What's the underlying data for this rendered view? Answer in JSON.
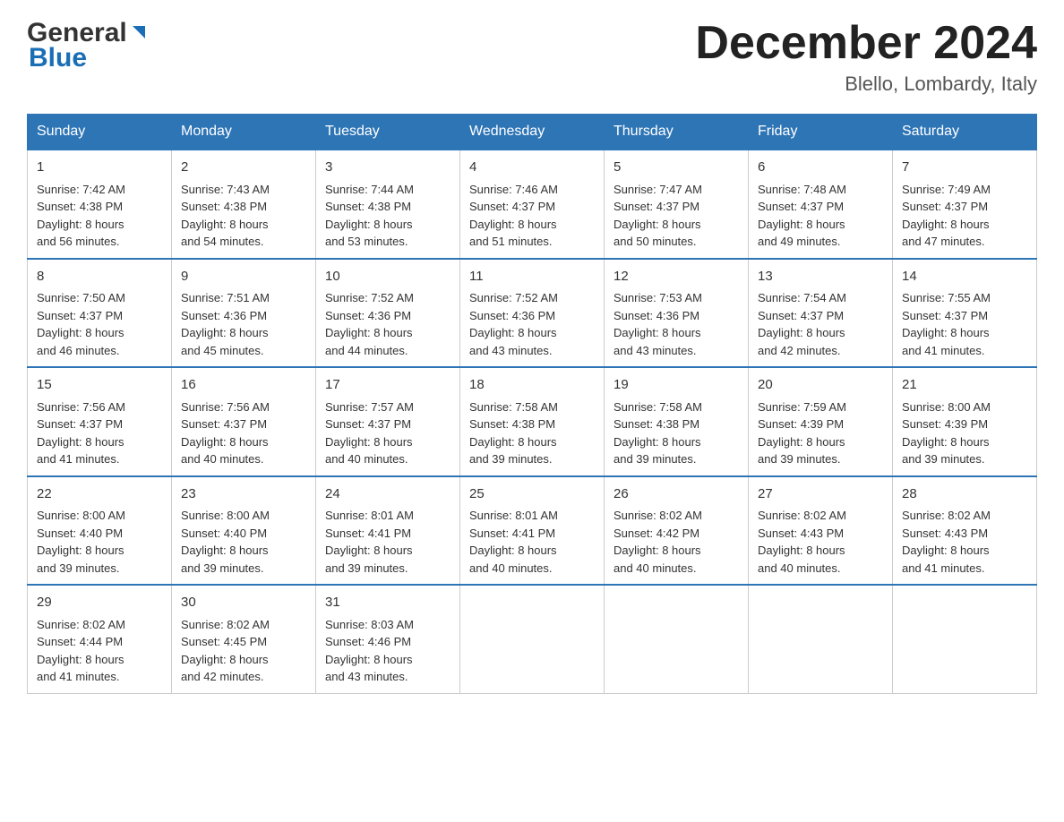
{
  "header": {
    "logo_line1": "General",
    "logo_line2": "Blue",
    "title": "December 2024",
    "subtitle": "Blello, Lombardy, Italy"
  },
  "days_of_week": [
    "Sunday",
    "Monday",
    "Tuesday",
    "Wednesday",
    "Thursday",
    "Friday",
    "Saturday"
  ],
  "weeks": [
    [
      {
        "num": "1",
        "sunrise": "7:42 AM",
        "sunset": "4:38 PM",
        "daylight": "8 hours and 56 minutes."
      },
      {
        "num": "2",
        "sunrise": "7:43 AM",
        "sunset": "4:38 PM",
        "daylight": "8 hours and 54 minutes."
      },
      {
        "num": "3",
        "sunrise": "7:44 AM",
        "sunset": "4:38 PM",
        "daylight": "8 hours and 53 minutes."
      },
      {
        "num": "4",
        "sunrise": "7:46 AM",
        "sunset": "4:37 PM",
        "daylight": "8 hours and 51 minutes."
      },
      {
        "num": "5",
        "sunrise": "7:47 AM",
        "sunset": "4:37 PM",
        "daylight": "8 hours and 50 minutes."
      },
      {
        "num": "6",
        "sunrise": "7:48 AM",
        "sunset": "4:37 PM",
        "daylight": "8 hours and 49 minutes."
      },
      {
        "num": "7",
        "sunrise": "7:49 AM",
        "sunset": "4:37 PM",
        "daylight": "8 hours and 47 minutes."
      }
    ],
    [
      {
        "num": "8",
        "sunrise": "7:50 AM",
        "sunset": "4:37 PM",
        "daylight": "8 hours and 46 minutes."
      },
      {
        "num": "9",
        "sunrise": "7:51 AM",
        "sunset": "4:36 PM",
        "daylight": "8 hours and 45 minutes."
      },
      {
        "num": "10",
        "sunrise": "7:52 AM",
        "sunset": "4:36 PM",
        "daylight": "8 hours and 44 minutes."
      },
      {
        "num": "11",
        "sunrise": "7:52 AM",
        "sunset": "4:36 PM",
        "daylight": "8 hours and 43 minutes."
      },
      {
        "num": "12",
        "sunrise": "7:53 AM",
        "sunset": "4:36 PM",
        "daylight": "8 hours and 43 minutes."
      },
      {
        "num": "13",
        "sunrise": "7:54 AM",
        "sunset": "4:37 PM",
        "daylight": "8 hours and 42 minutes."
      },
      {
        "num": "14",
        "sunrise": "7:55 AM",
        "sunset": "4:37 PM",
        "daylight": "8 hours and 41 minutes."
      }
    ],
    [
      {
        "num": "15",
        "sunrise": "7:56 AM",
        "sunset": "4:37 PM",
        "daylight": "8 hours and 41 minutes."
      },
      {
        "num": "16",
        "sunrise": "7:56 AM",
        "sunset": "4:37 PM",
        "daylight": "8 hours and 40 minutes."
      },
      {
        "num": "17",
        "sunrise": "7:57 AM",
        "sunset": "4:37 PM",
        "daylight": "8 hours and 40 minutes."
      },
      {
        "num": "18",
        "sunrise": "7:58 AM",
        "sunset": "4:38 PM",
        "daylight": "8 hours and 39 minutes."
      },
      {
        "num": "19",
        "sunrise": "7:58 AM",
        "sunset": "4:38 PM",
        "daylight": "8 hours and 39 minutes."
      },
      {
        "num": "20",
        "sunrise": "7:59 AM",
        "sunset": "4:39 PM",
        "daylight": "8 hours and 39 minutes."
      },
      {
        "num": "21",
        "sunrise": "8:00 AM",
        "sunset": "4:39 PM",
        "daylight": "8 hours and 39 minutes."
      }
    ],
    [
      {
        "num": "22",
        "sunrise": "8:00 AM",
        "sunset": "4:40 PM",
        "daylight": "8 hours and 39 minutes."
      },
      {
        "num": "23",
        "sunrise": "8:00 AM",
        "sunset": "4:40 PM",
        "daylight": "8 hours and 39 minutes."
      },
      {
        "num": "24",
        "sunrise": "8:01 AM",
        "sunset": "4:41 PM",
        "daylight": "8 hours and 39 minutes."
      },
      {
        "num": "25",
        "sunrise": "8:01 AM",
        "sunset": "4:41 PM",
        "daylight": "8 hours and 40 minutes."
      },
      {
        "num": "26",
        "sunrise": "8:02 AM",
        "sunset": "4:42 PM",
        "daylight": "8 hours and 40 minutes."
      },
      {
        "num": "27",
        "sunrise": "8:02 AM",
        "sunset": "4:43 PM",
        "daylight": "8 hours and 40 minutes."
      },
      {
        "num": "28",
        "sunrise": "8:02 AM",
        "sunset": "4:43 PM",
        "daylight": "8 hours and 41 minutes."
      }
    ],
    [
      {
        "num": "29",
        "sunrise": "8:02 AM",
        "sunset": "4:44 PM",
        "daylight": "8 hours and 41 minutes."
      },
      {
        "num": "30",
        "sunrise": "8:02 AM",
        "sunset": "4:45 PM",
        "daylight": "8 hours and 42 minutes."
      },
      {
        "num": "31",
        "sunrise": "8:03 AM",
        "sunset": "4:46 PM",
        "daylight": "8 hours and 43 minutes."
      },
      null,
      null,
      null,
      null
    ]
  ],
  "labels": {
    "sunrise": "Sunrise:",
    "sunset": "Sunset:",
    "daylight": "Daylight:"
  }
}
